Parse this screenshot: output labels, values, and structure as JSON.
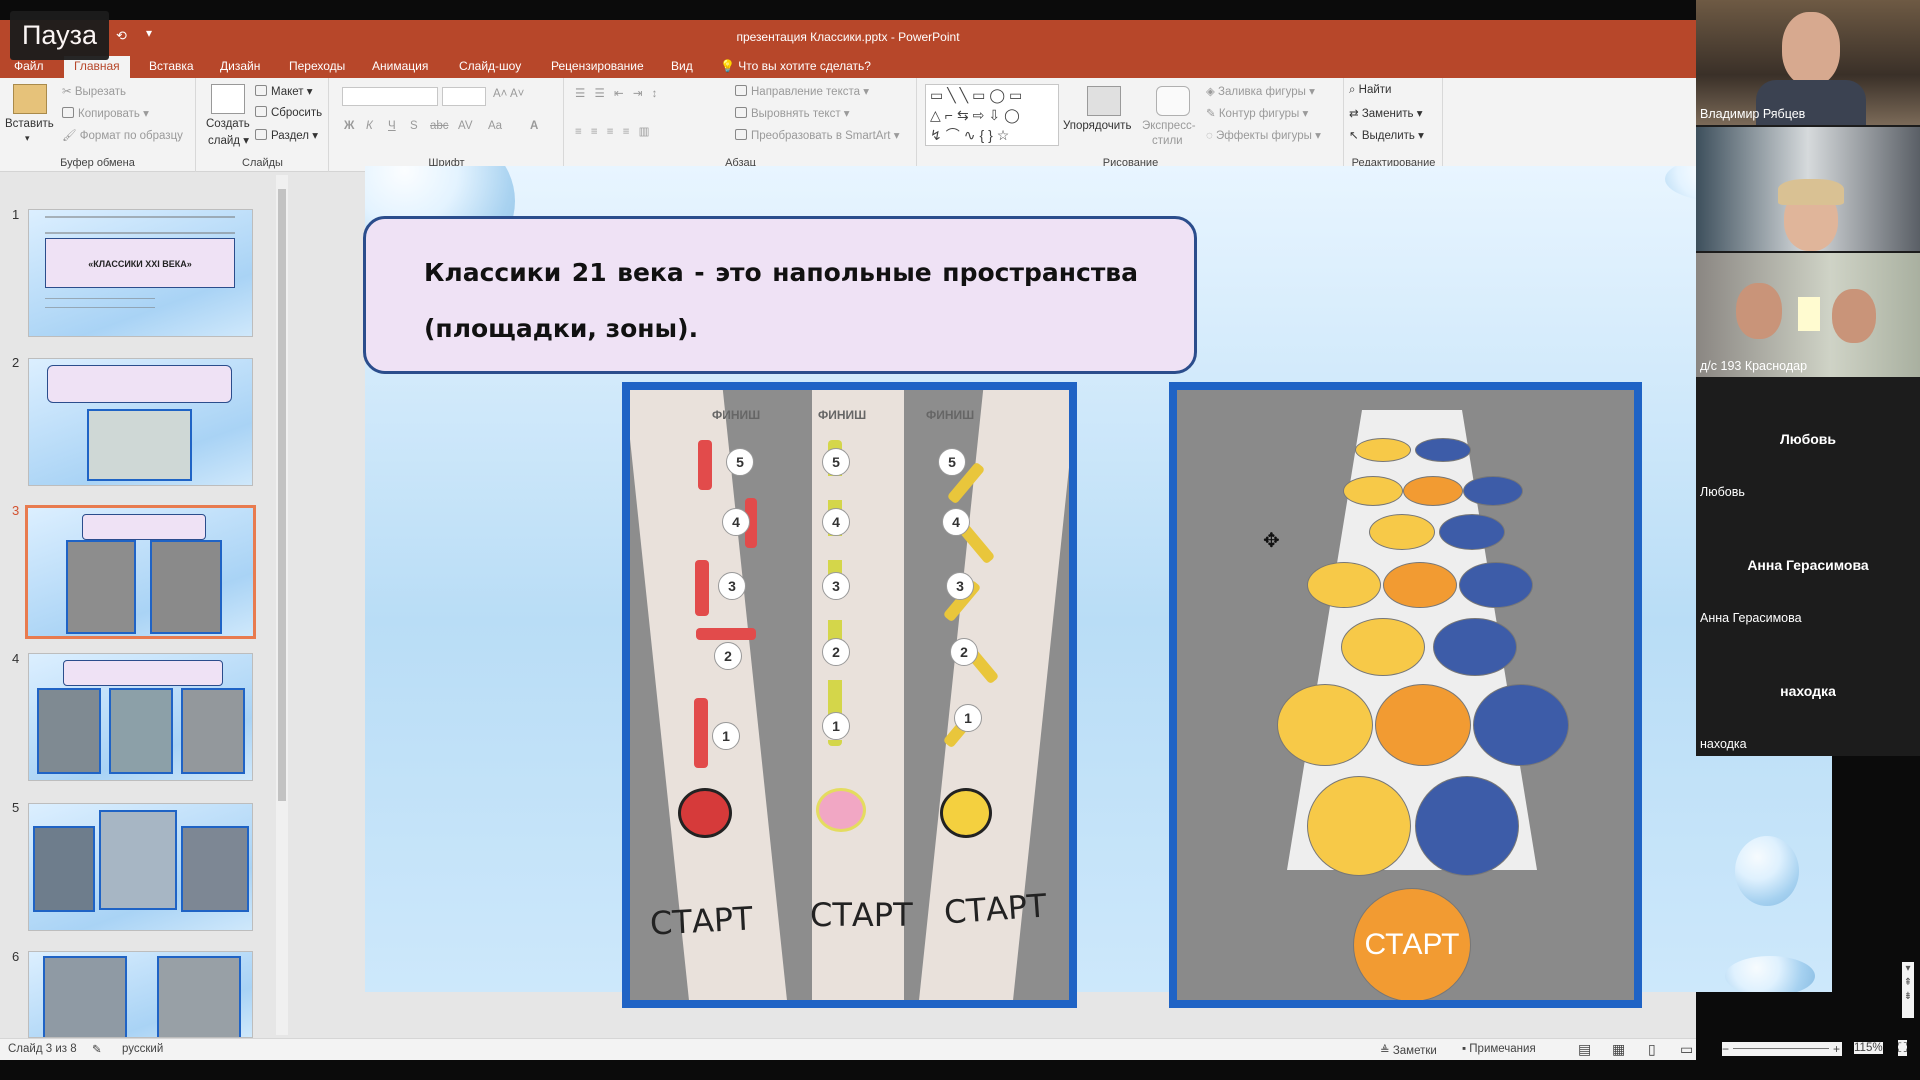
{
  "overlay": {
    "pause_label": "Пауза"
  },
  "window": {
    "title": "презентация Классики.pptx - PowerPoint"
  },
  "tabs": [
    {
      "label": "Файл"
    },
    {
      "label": "Главная"
    },
    {
      "label": "Вставка"
    },
    {
      "label": "Дизайн"
    },
    {
      "label": "Переходы"
    },
    {
      "label": "Анимация"
    },
    {
      "label": "Слайд-шоу"
    },
    {
      "label": "Рецензирование"
    },
    {
      "label": "Вид"
    },
    {
      "label": "Что вы хотите сделать?"
    }
  ],
  "ribbon": {
    "clipboard": {
      "group": "Буфер обмена",
      "paste": "Вставить",
      "cut": "Вырезать",
      "copy": "Копировать",
      "format_painter": "Формат по образцу"
    },
    "slides": {
      "group": "Слайды",
      "new_slide_1": "Создать",
      "new_slide_2": "слайд",
      "layout": "Макет",
      "reset": "Сбросить",
      "section": "Раздел"
    },
    "font": {
      "group": "Шрифт",
      "bold": "Ж",
      "italic": "К",
      "underline": "Ч",
      "shadow": "S",
      "strike": "abc",
      "spacing": "AV",
      "case": "Aa",
      "color": "A"
    },
    "paragraph": {
      "group": "Абзац",
      "text_direction": "Направление текста",
      "align_text": "Выровнять текст",
      "smartart": "Преобразовать в SmartArt"
    },
    "drawing": {
      "group": "Рисование",
      "arrange": "Упорядочить",
      "quick_styles_1": "Экспресс-",
      "quick_styles_2": "стили",
      "shape_fill": "Заливка фигуры",
      "shape_outline": "Контур фигуры",
      "shape_effects": "Эффекты фигуры"
    },
    "editing": {
      "group": "Редактирование",
      "find": "Найти",
      "replace": "Заменить",
      "select": "Выделить"
    }
  },
  "thumbnails": [
    {
      "number": "1",
      "title": "«КЛАССИКИ XXI ВЕКА»"
    },
    {
      "number": "2"
    },
    {
      "number": "3"
    },
    {
      "number": "4"
    },
    {
      "number": "5"
    },
    {
      "number": "6"
    }
  ],
  "slide": {
    "heading": "Классики 21 века - это напольные пространства (площадки, зоны).",
    "photo1": {
      "finish": "ФИНИШ",
      "start": "СТАРТ",
      "numbers": [
        "1",
        "2",
        "3",
        "4",
        "5"
      ]
    },
    "photo2": {
      "start": "СТАРТ"
    }
  },
  "status": {
    "slide_info": "Слайд 3 из 8",
    "language": "русский",
    "notes": "Заметки",
    "comments": "Примечания",
    "zoom": "115%"
  },
  "participants": [
    {
      "name": "Владимир Рябцев",
      "video": true
    },
    {
      "name": "",
      "video": true
    },
    {
      "name": "д/с 193 Краснодар",
      "video": true
    },
    {
      "name": "Любовь",
      "video": false
    },
    {
      "name": "Анна Герасимова",
      "video": false
    },
    {
      "name": "находка",
      "video": false
    }
  ],
  "colors": {
    "accent": "#b7472a",
    "selection": "#e87b4f",
    "frame": "#1f63c5"
  }
}
